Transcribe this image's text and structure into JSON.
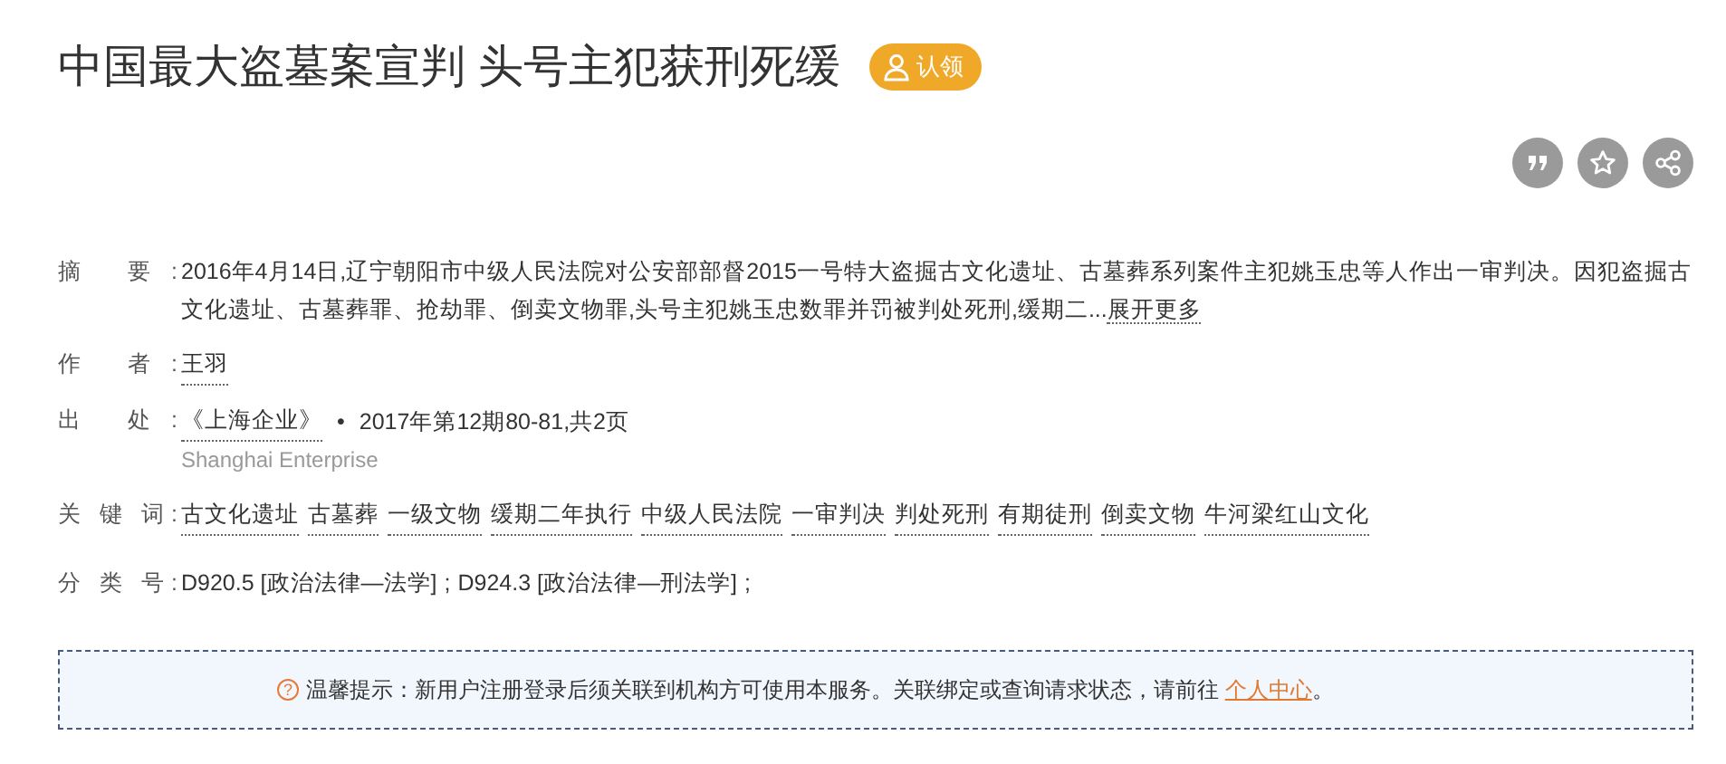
{
  "title": "中国最大盗墓案宣判 头号主犯获刑死缓",
  "claim_button": {
    "label": "认领"
  },
  "actions": [
    {
      "kind": "quote"
    },
    {
      "kind": "star"
    },
    {
      "kind": "share"
    }
  ],
  "fields": [
    {
      "kind": "abstract",
      "label": "摘 要:",
      "text": "2016年4月14日,辽宁朝阳市中级人民法院对公安部部督2015一号特大盗掘古文化遗址、古墓葬系列案件主犯姚玉忠等人作出一审判决。因犯盗掘古文化遗址、古墓葬罪、抢劫罪、倒卖文物罪,头号主犯姚玉忠数罪并罚被判处死刑,缓期二...",
      "link": "展开更多"
    },
    {
      "kind": "links",
      "label": "作 者:",
      "items": [
        "王羽"
      ]
    },
    {
      "kind": "source",
      "label": "出 处:",
      "journal": "《上海企业》",
      "separator": "•",
      "issue": "2017年第12期80-81,共2页",
      "subtitle": "Shanghai Enterprise"
    },
    {
      "kind": "links",
      "label": "关 键 词:",
      "items": [
        "古文化遗址",
        "古墓葬",
        "一级文物",
        "缓期二年执行",
        "中级人民法院",
        "一审判决",
        "判处死刑",
        "有期徒刑",
        "倒卖文物",
        "牛河梁红山文化"
      ]
    },
    {
      "kind": "codes",
      "label": "分 类 号:",
      "items": [
        "D920.5 [政治法律—法学]",
        "D924.3 [政治法律—刑法学]"
      ],
      "separator": ";"
    }
  ],
  "notice": {
    "icon": "?",
    "text": "温馨提示：新用户注册登录后须关联到机构方可使用本服务。关联绑定或查询请求状态，请前往",
    "link": "个人中心",
    "end": "。"
  }
}
